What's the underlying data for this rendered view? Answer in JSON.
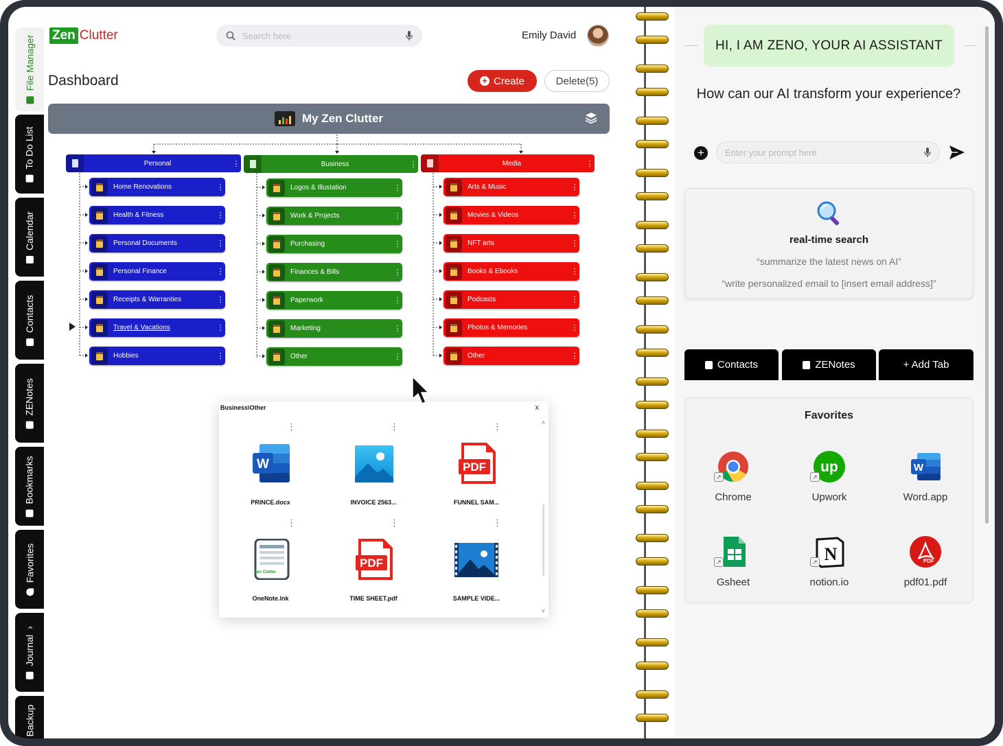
{
  "sidebar": {
    "tabs": [
      {
        "label": "File Manager",
        "active": true
      },
      {
        "label": "To Do List"
      },
      {
        "label": "Calendar"
      },
      {
        "label": "Contacts"
      },
      {
        "label": "ZENotes"
      },
      {
        "label": "Bookmarks"
      },
      {
        "label": "Favorites"
      },
      {
        "label": "Journal"
      },
      {
        "label": "Backup"
      }
    ],
    "journal_chevron": "›"
  },
  "header": {
    "logo_part1": "Zen",
    "logo_part2": "Clutter",
    "search_placeholder": "Search here",
    "user_name": "Emily David"
  },
  "dashboard": {
    "title": "Dashboard",
    "create_label": "Create",
    "delete_label": "Delete(5)",
    "banner_title": "My Zen Clutter"
  },
  "tree": {
    "categories": [
      {
        "label": "Personal",
        "color": "#1a1fc9",
        "items": [
          "Home Renovations",
          "Health & Fitness",
          "Personal Documents",
          "Personal Finance",
          "Receipts & Warranties",
          "Travel & Vacations",
          "Hobbies"
        ]
      },
      {
        "label": "Business",
        "color": "#268c1a",
        "items": [
          "Logos & Illustation",
          "Work & Projects",
          "Purchasing",
          "Finances & Bills",
          "Paperwork",
          "Marketing",
          "Other"
        ]
      },
      {
        "label": "Media",
        "color": "#ee0f0f",
        "items": [
          "Arts & Music",
          "Movies & Videos",
          "NFT arts",
          "Books & Ebooks",
          "Podcasts",
          "Photos & Memories",
          "Other"
        ]
      }
    ],
    "menu_glyph": "⋮"
  },
  "file_panel": {
    "path": "Business\\Other",
    "close": "x",
    "files": [
      {
        "name": "PRINCE.docx",
        "icon": "word-icon"
      },
      {
        "name": "INVOICE 2563...",
        "icon": "image-icon"
      },
      {
        "name": "FUNNEL SAM...",
        "icon": "pdf-icon"
      },
      {
        "name": "OneNote.lnk",
        "icon": "onenote-icon"
      },
      {
        "name": "TIME SHEET.pdf",
        "icon": "pdf-icon"
      },
      {
        "name": "SAMPLE VIDE...",
        "icon": "video-icon"
      }
    ],
    "word_letter": "W",
    "pdf_text": "PDF",
    "onenote_brand": "Zen Clutter"
  },
  "assistant": {
    "title": "HI, I AM ZENO, YOUR AI ASSISTANT",
    "subtitle": "How can our AI transform your experience?",
    "prompt_placeholder": "Enter your prompt here",
    "card_title": "real-time search",
    "examples": [
      "“summarize the latest news on AI”",
      "“write personalized email to [insert email address]”"
    ]
  },
  "tabs": [
    {
      "label": "Contacts"
    },
    {
      "label": "ZENotes"
    },
    {
      "label": "+ Add Tab"
    }
  ],
  "favorites": {
    "title": "Favorites",
    "items": [
      {
        "name": "Chrome",
        "icon": "chrome-icon"
      },
      {
        "name": "Upwork",
        "icon": "upwork-icon"
      },
      {
        "name": "Word.app",
        "icon": "word-icon"
      },
      {
        "name": "Gsheet",
        "icon": "gsheet-icon"
      },
      {
        "name": "notion.io",
        "icon": "notion-icon"
      },
      {
        "name": "pdf01.pdf",
        "icon": "pdf-icon"
      }
    ],
    "upwork_text": "up",
    "word_letter": "W",
    "notion_letter": "N",
    "pdf_badge": "PDF"
  },
  "colors": {
    "accent_green": "#2e8b27",
    "create_red": "#d9261c",
    "banner_gray": "#6b7584"
  }
}
